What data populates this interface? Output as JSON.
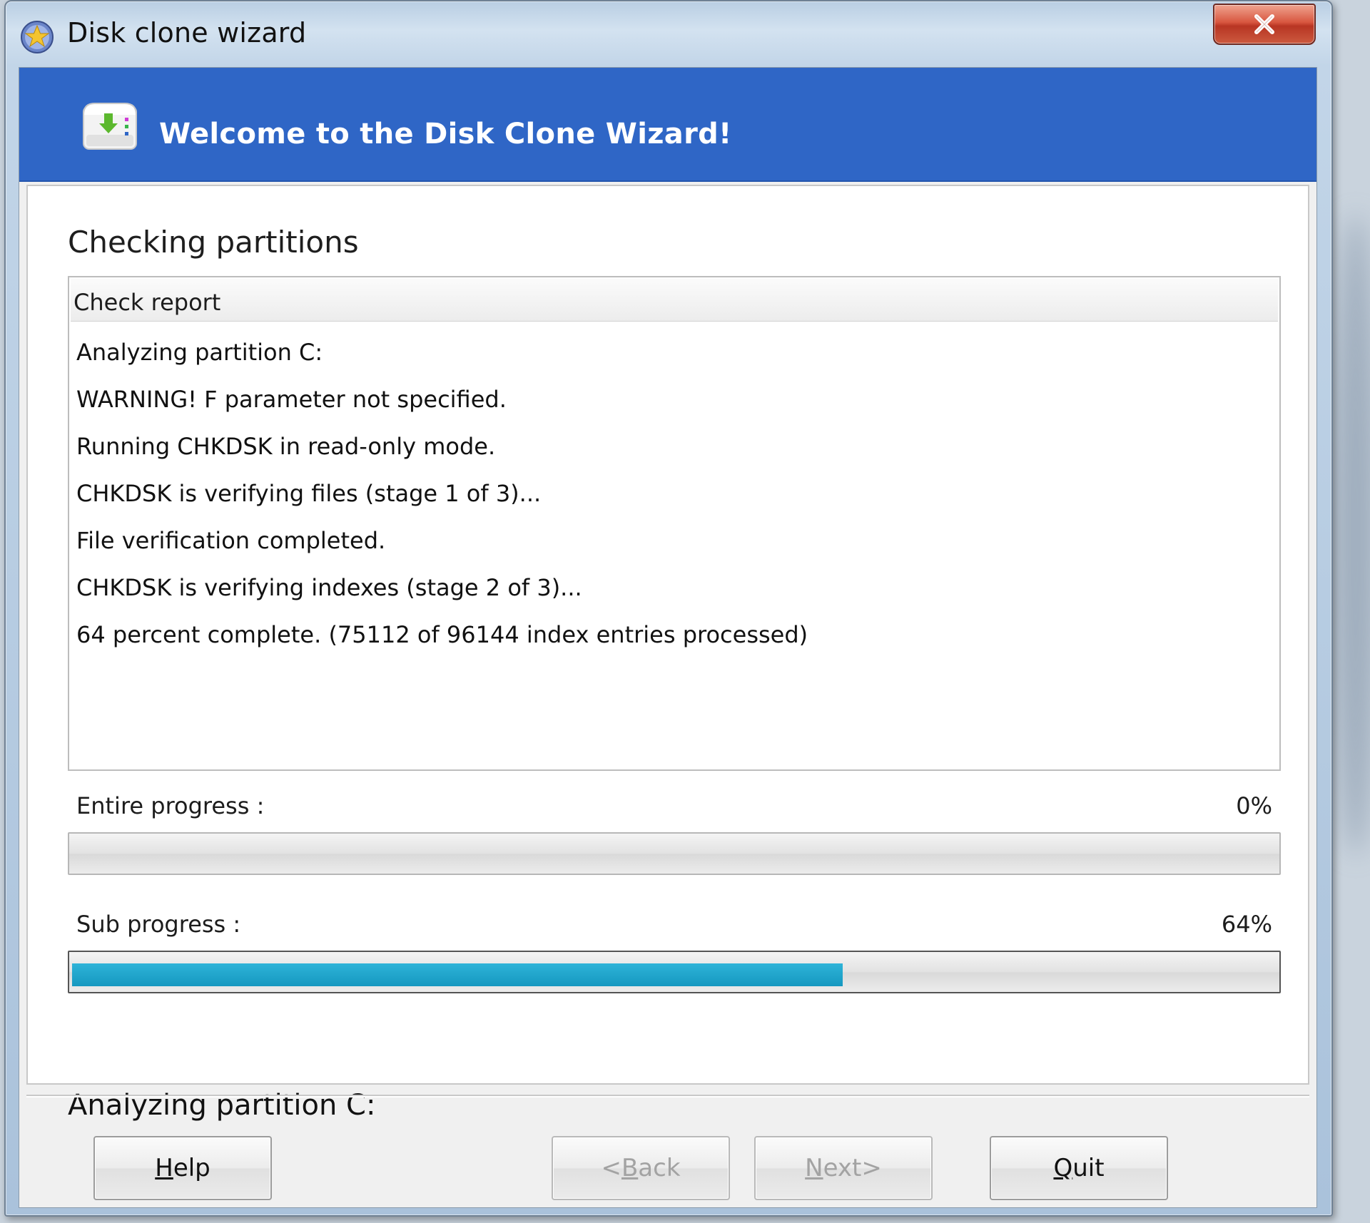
{
  "window": {
    "title": "Disk clone wizard",
    "close_glyph": "✕"
  },
  "banner": {
    "title": "Welcome to the Disk Clone Wizard!"
  },
  "content": {
    "section_title": "Checking partitions",
    "report": {
      "header": "Check report",
      "lines": [
        "Analyzing partition C:",
        "WARNING!  F parameter not specified.",
        "Running CHKDSK in read-only mode.",
        "CHKDSK is verifying files (stage 1 of 3)...",
        "File verification completed.",
        "CHKDSK is verifying indexes (stage 2 of 3)...",
        "64 percent complete. (75112 of 96144 index entries processed)"
      ]
    },
    "entire_progress": {
      "label": "Entire progress :",
      "percent_text": "0%",
      "fraction": 0.0
    },
    "sub_progress": {
      "label": "Sub progress :",
      "percent_text": "64%",
      "fraction": 0.64
    },
    "status": "Analyzing partition C:"
  },
  "buttons": {
    "help": {
      "mnemonic": "H",
      "rest": "elp",
      "enabled": true
    },
    "back": {
      "prefix": "<",
      "mnemonic": "B",
      "rest": "ack",
      "enabled": false
    },
    "next": {
      "prefix": "",
      "mnemonic": "N",
      "rest": "ext>",
      "enabled": false
    },
    "quit": {
      "mnemonic": "Q",
      "rest": "uit",
      "enabled": true
    }
  },
  "colors": {
    "banner_blue": "#2f66c6",
    "progress_fill": "#1598c0",
    "close_red": "#c8452f",
    "disabled_text": "#a3a3a3"
  },
  "icons": {
    "app": "app-star-icon",
    "banner": "disk-clone-icon",
    "close": "close-icon"
  }
}
